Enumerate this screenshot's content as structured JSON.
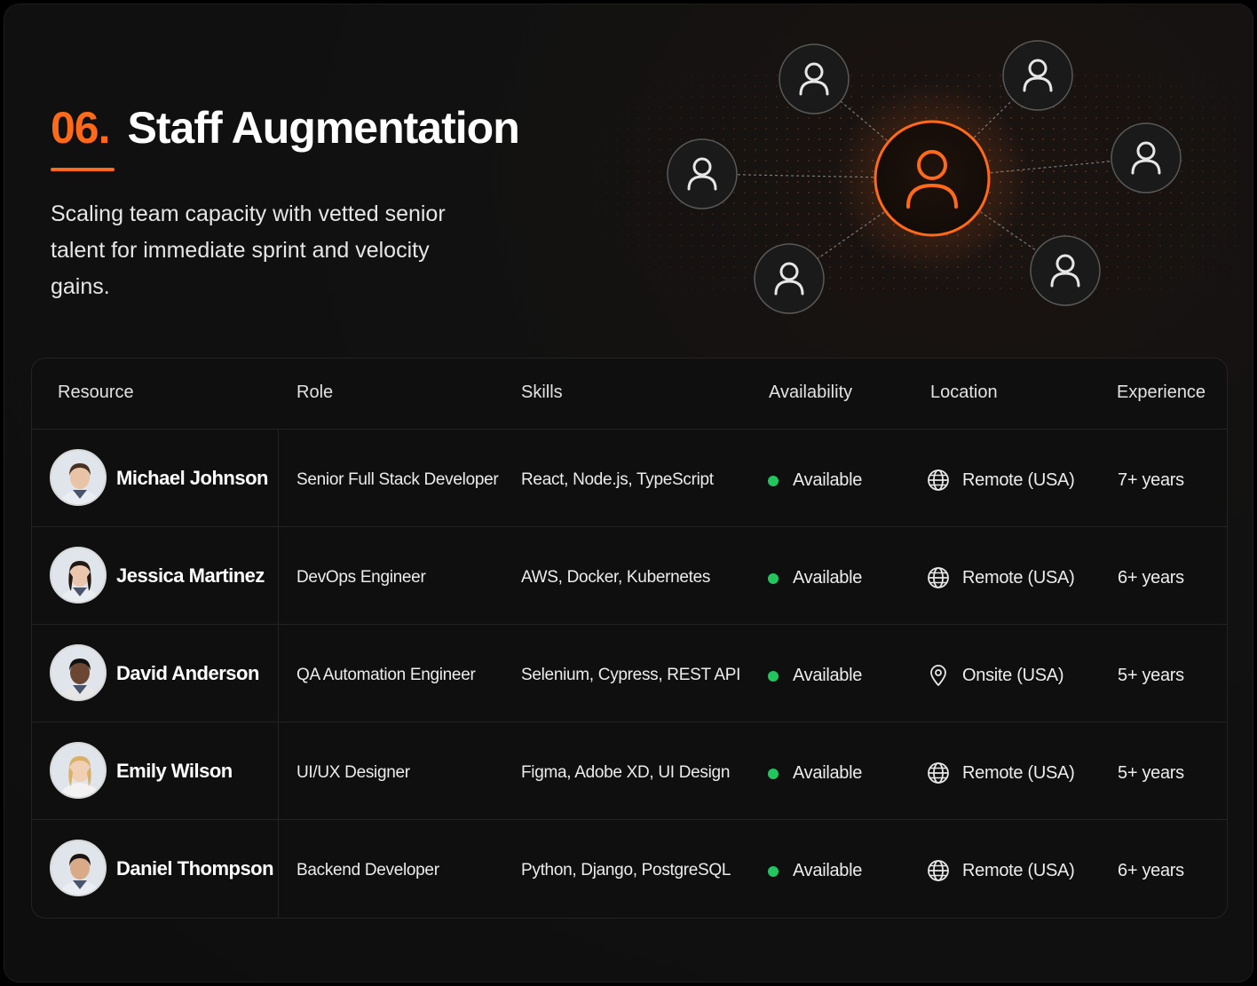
{
  "header": {
    "number": "06.",
    "title": "Staff Augmentation",
    "subtitle": "Scaling team capacity with vetted senior talent for immediate sprint and velocity gains."
  },
  "colors": {
    "accent": "#ff6a1a",
    "available": "#22c55e",
    "background": "#111111"
  },
  "network": {
    "center_icon": "user-icon",
    "satellite_icon": "user-icon",
    "satellite_count": 6
  },
  "table": {
    "columns": [
      "Resource",
      "Role",
      "Skills",
      "Availability",
      "Location",
      "Experience"
    ],
    "rows": [
      {
        "name": "Michael Johnson",
        "role": "Senior Full Stack Developer",
        "skills": "React, Node.js, TypeScript",
        "availability": "Available",
        "location": "Remote (USA)",
        "location_icon": "globe-icon",
        "experience": "7+ years",
        "avatar": "avatar-photo"
      },
      {
        "name": "Jessica Martinez",
        "role": "DevOps Engineer",
        "skills": "AWS, Docker, Kubernetes",
        "availability": "Available",
        "location": "Remote (USA)",
        "location_icon": "globe-icon",
        "experience": "6+ years",
        "avatar": "avatar-photo"
      },
      {
        "name": "David Anderson",
        "role": "QA Automation Engineer",
        "skills": "Selenium, Cypress, REST API",
        "availability": "Available",
        "location": "Onsite (USA)",
        "location_icon": "map-pin-icon",
        "experience": "5+ years",
        "avatar": "avatar-photo"
      },
      {
        "name": "Emily Wilson",
        "role": "UI/UX Designer",
        "skills": "Figma, Adobe XD, UI Design",
        "availability": "Available",
        "location": "Remote (USA)",
        "location_icon": "globe-icon",
        "experience": "5+ years",
        "avatar": "avatar-photo"
      },
      {
        "name": "Daniel Thompson",
        "role": "Backend Developer",
        "skills": "Python, Django, PostgreSQL",
        "availability": "Available",
        "location": "Remote (USA)",
        "location_icon": "globe-icon",
        "experience": "6+ years",
        "avatar": "avatar-photo"
      }
    ]
  }
}
